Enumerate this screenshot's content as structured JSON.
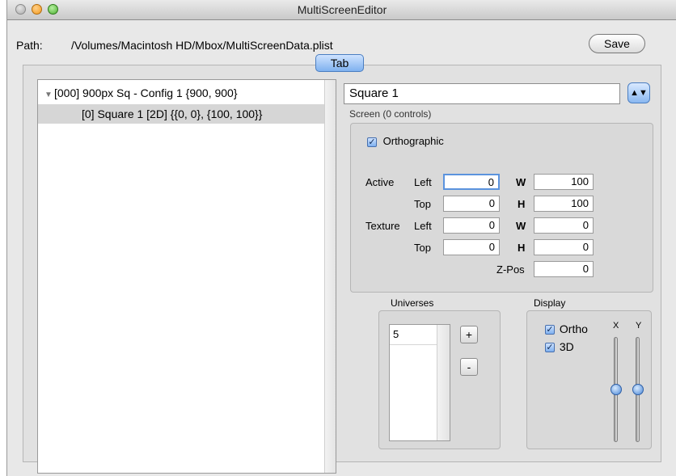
{
  "window": {
    "title": "MultiScreenEditor"
  },
  "path": {
    "label": "Path:",
    "value": "/Volumes/Macintosh HD/Mbox/MultiScreenData.plist"
  },
  "toolbar": {
    "save_label": "Save",
    "tab_label": "Tab"
  },
  "outline": {
    "items": [
      {
        "text": "[000] 900px Sq - Config 1 {900, 900}",
        "expanded": true,
        "selected": false
      },
      {
        "text": "[0] Square 1  [2D] {{0, 0}, {100, 100}}",
        "selected": true
      }
    ]
  },
  "screen": {
    "name": "Square 1",
    "caption": "Screen (0 controls)",
    "orthographic_label": "Orthographic",
    "orthographic_checked": true,
    "active_label": "Active",
    "texture_label": "Texture",
    "left_label": "Left",
    "top_label": "Top",
    "w_label": "W",
    "h_label": "H",
    "zpos_label": "Z-Pos",
    "active": {
      "left": "0",
      "top": "0",
      "w": "100",
      "h": "100"
    },
    "texture": {
      "left": "0",
      "top": "0",
      "w": "0",
      "h": "0"
    },
    "zpos": "0"
  },
  "universes": {
    "label": "Universes",
    "items": [
      "5"
    ],
    "add_label": "+",
    "remove_label": "-"
  },
  "display": {
    "label": "Display",
    "ortho_label": "Ortho",
    "threed_label": "3D",
    "ortho_checked": true,
    "threed_checked": true,
    "x_label": "X",
    "y_label": "Y",
    "x_value": 0.5,
    "y_value": 0.5
  },
  "glyphs": {
    "check": "✓",
    "disclosure": "▼",
    "popup": "▲▼"
  },
  "colors": {
    "accent": "#5b93de",
    "selection": "#d6d6d6"
  }
}
